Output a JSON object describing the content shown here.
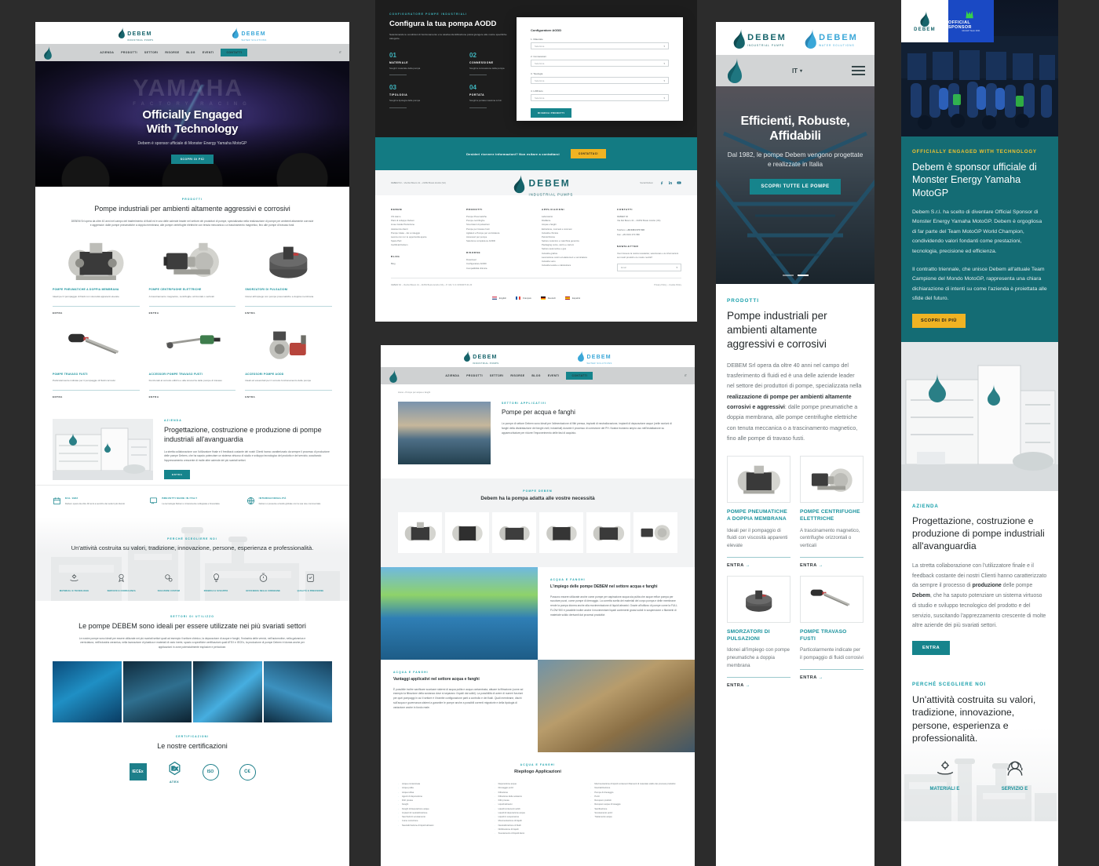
{
  "brand": {
    "name": "DEBEM",
    "tagline_dark": "INDUSTRIAL PUMPS",
    "tagline_light": "WATER SOLUTIONS",
    "colors": {
      "teal": "#16848c",
      "teal_dark": "#137b83",
      "cyan": "#18a0ab",
      "yellow": "#f0b323",
      "dark": "#1d1d1d"
    }
  },
  "desktop_home": {
    "nav": {
      "items": [
        "AZIENDA",
        "PRODOTTI",
        "SETTORI",
        "RISORSE",
        "BLOG",
        "EVENTI"
      ],
      "cta": "CONTATTI",
      "lang": "IT"
    },
    "hero": {
      "watermark": "YAMAHA",
      "watermark_sub": "FACTORY RACING",
      "title_line1": "Officially Engaged",
      "title_line2": "With Technology",
      "subtitle": "Debem è sponsor ufficiale di Monster Energy Yamaha MotoGP",
      "button": "SCOPRI DI PIÙ"
    },
    "products": {
      "eyebrow": "PRODOTTI",
      "title": "Pompe industriali per ambienti altamente aggressivi e corrosivi",
      "body": "DEBEM Srl opera da oltre 40 anni nel campo del trasferimento di fluidi ed è una delle aziende leader nel settore dei produttori di pompe, specializzata nella realizzazione di pompe per ambienti altamente corrosivi e aggressivi: dalle pompe pneumatiche a doppia membrana, alle pompe centrifughe elettriche con tenuta meccanica o a trascinamento magnetico, fino alle pompe di travaso fusti.",
      "cards": [
        {
          "icon": "aodd-pump-icon",
          "name": "POMPE PNEUMATICHE A DOPPIA MEMBRANA",
          "desc": "Ideali per il pompaggio di fluidi con viscosità apparenti elevate",
          "link": "ENTRA"
        },
        {
          "icon": "centrifugal-pump-icon",
          "name": "POMPE CENTRIFUGHE ELETTRICHE",
          "desc": "A trascinamento magnetico, centrifughe orizzontali o verticali",
          "link": "ENTRA"
        },
        {
          "icon": "pulsation-damper-icon",
          "name": "SMORZATORI DI PULSAZIONI",
          "desc": "Idonei all'impiego con pompe pneumatiche a doppia membrana",
          "link": "ENTRA"
        },
        {
          "icon": "drum-pump-icon",
          "name": "POMPE TRAVASO FUSTI",
          "desc": "Particolarmente indicate per il pompaggio di fluidi corrosivi",
          "link": "ENTRA"
        },
        {
          "icon": "lance-pump-icon",
          "name": "ACCESSORI POMPE TRAVASO FUSTI",
          "desc": "Funzionali al corretto utilizzo e alla sicurezza delle pompe di travaso",
          "link": "ENTRA"
        },
        {
          "icon": "accessories-icon",
          "name": "ACCESSORI POMPE AODD",
          "desc": "Ideali ed essenziali per il corretto funzionamento delle pompe",
          "link": "ENTRA"
        }
      ]
    },
    "company": {
      "eyebrow": "AZIENDA",
      "title": "Progettazione, costruzione e produzione di pompe industriali all'avanguardia",
      "body": "La stretta collaborazione con l'utilizzatore finale e il feedback costante dei nostri Clienti hanno caratterizzato da sempre il processo di produzione delle pompe Debem, che ha saputo potenziare un sistema virtuoso di studio e sviluppo tecnologico del prodotto e del servizio, suscitando l'apprezzamento crescente di molte altre aziende dei più svariati settori.",
      "button": "ENTRA",
      "photo": "debem-headquarters-photo"
    },
    "highlights": [
      {
        "icon": "calendar-icon",
        "title": "DAL 1982",
        "desc": "Debem opera da oltre 40 anni a servizio dei settori più diversi"
      },
      {
        "icon": "certificate-icon",
        "title": "BREVETTI MADE IN ITALY",
        "desc": "La tecnologia Debem è interamente sviluppata e brevettata"
      },
      {
        "icon": "globe-icon",
        "title": "INTERNAZIONALITÀ",
        "desc": "Debem è presente a livello globale con la sua rete commerciale"
      }
    ],
    "why": {
      "eyebrow": "PERCHÉ SCEGLIERE NOI",
      "title": "Un'attività costruita su valori, tradizione, innovazione, persone, esperienza e professionalità.",
      "values": [
        {
          "icon": "hand-gear-icon",
          "label": "MATERIALI E TECNOLOGIE"
        },
        {
          "icon": "medal-icon",
          "label": "SERVIZIO E CONSULENZA"
        },
        {
          "icon": "gears-icon",
          "label": "SOLUZIONI CUSTOM"
        },
        {
          "icon": "lightbulb-icon",
          "label": "RICERCA E SVILUPPO"
        },
        {
          "icon": "stopwatch-icon",
          "label": "EFFICIENZA NELLE CONSEGNE"
        },
        {
          "icon": "clipboard-check-icon",
          "label": "QUALITÀ E PRECISIONE"
        }
      ]
    },
    "sectors": {
      "eyebrow": "SETTORI DI UTILIZZO",
      "title": "Le pompe DEBEM sono ideali per essere utilizzate nei più svariati settori",
      "body": "Le nostre pompe sono ideali per essere utilizzate nei più svariati settori quali ad esempio il settore chimico, la depurazione di acque e fanghi, l'industria delle vernici, nell'automotive, nella galvanica e verniciatura, nell'industria ceramica, nella lavorazione di plastica e materiali di vario inerte, spazio a specifiche certificazioni quali ATEX e IECEx, la produzione di pompe Debem è idonea anche per applicazioni in zone potenzialmente esplosive e pericolose.",
      "photos": [
        "lab-glassware-photo",
        "metal-machining-photo",
        "spray-painting-photo",
        "refinery-tanks-photo"
      ]
    },
    "certs": {
      "eyebrow": "CERTIFICAZIONI",
      "title": "Le nostre certificazioni",
      "badges": [
        "IECEx",
        "ATEX",
        "ISO 9001",
        "CE"
      ]
    }
  },
  "configurator": {
    "eyebrow": "CONFIGURATORE POMPE INDUSTRIALI",
    "title": "Configura la tua pompa AODD",
    "subtitle": "Selezionando le condizioni di funzionamento e la relativa identificazione potrai giungere alle nostre specifiche categorie.",
    "steps": [
      {
        "n": "01",
        "t": "MATERIALE",
        "d": "Scegli il materiale della pompa"
      },
      {
        "n": "02",
        "t": "CONNESSIONE",
        "d": "Scegli la connessione della pompa"
      },
      {
        "n": "03",
        "t": "TIPOLOGIA",
        "d": "Scegli la tipologia della pompa"
      },
      {
        "n": "04",
        "t": "PORTATA",
        "d": "Scegli la portata massima L/min"
      }
    ],
    "card": {
      "title": "Configuratore AODD",
      "fields": [
        {
          "label": "1. Materiale",
          "value": "Seleziona"
        },
        {
          "label": "2. Connessioni",
          "value": "Seleziona"
        },
        {
          "label": "3. Tipologia",
          "value": "Seleziona"
        },
        {
          "label": "4. Lt/Minuto",
          "value": "Seleziona"
        }
      ],
      "button": "RICERCA PRODOTTI"
    }
  },
  "footer_page": {
    "cta": {
      "text": "Desideri ricevere informazioni? Non esitare a contattarci",
      "button": "CONTATTACI"
    },
    "address": "DEBEM Srl – Via Del Bosco 41 – 21052 Busto Arsizio (VA)",
    "social_label": "Social Debem",
    "social": [
      "facebook-icon",
      "linkedin-icon",
      "youtube-icon"
    ],
    "columns": [
      {
        "title": "DEBEM",
        "items": [
          "Chi siamo",
          "Piani di sviluppo Debem",
          "Linee Guida Produzione",
          "Assistenza clienti",
          "Pompe Usate – Ex a noleggio",
          "Lavora con noi: le opportunità aperte",
          "Spare Part",
          "Certificati Debem"
        ]
      },
      {
        "title": "PRODOTTI",
        "items": [
          "Pompe Pneumatiche",
          "Pompe centrifughe",
          "Smorzatori di pulsazioni",
          "Pompe per travaso fusti",
          "Agitatori e Pompe per verniciatura",
          "Accessori per pompe",
          "Selezione completa su AODD"
        ]
      },
      {
        "title": "APPLICAZIONI",
        "items": [
          "Laboratorio",
          "Distillerie",
          "Acqua e fanghi",
          "Estrazione, cosmesi e cosmesi",
          "Industria chimica",
          "Petrolchimica",
          "Settore ceramico e macchina generica",
          "Packaging conto, cartro e cartoni",
          "Settore automotive e gas",
          "Industria grafica",
          "Lavorazione colori ed elastomeri e verniciatura",
          "Industria vetro",
          "Industria tessile e calzaturiera"
        ]
      },
      {
        "title": "CONTATTI",
        "items": [
          "DEBEM Srl",
          "Via Del Bosco 41 – 21052 Busto Arsizio (VA)"
        ]
      }
    ],
    "contacts_extra": {
      "phone_label": "Telefono:",
      "phone": "+39 0331 074 518",
      "fax_label": "Fax:",
      "fax": "+39 0331 074 580"
    },
    "newsletter": {
      "title": "NEWSLETTER",
      "desc": "Vuoi ricevere la nostra newsletter, selezionare e le informazioni sui nostri prodotti e le nostre novità?",
      "placeholder": "Email"
    },
    "legal": "DEBEM Srl – Via Del Bosco 41 – 21052 Busto Arsizio (VA) – P. IVA / C.F. 01504073 01 20",
    "legal_links": "Privacy Policy – Cookie Policy",
    "languages": [
      "English",
      "Français",
      "Deutsch",
      "Español"
    ]
  },
  "app_page": {
    "breadcrumb": "Home › Pompe per acqua e fanghi",
    "hero": {
      "eyebrow": "SETTORI APPLICATIVI",
      "title": "Pompe per acqua e fanghi",
      "body": "Le pompe di settore Debem sono ideali per l'alimentazione di filtri pressa, impianti di neutralizzazione, impianti di depurazione acque (nelle sezioni di fanghi della disidratazione dei fanghi civili, industriali) durante il processo di correzione del PH. Nostra troviamo ampio uso nell'installazione su apparecchiature per ridurre l'impoverimento delle fasi di acquisto.",
      "photo": "water-treatment-plant-photo"
    },
    "band": {
      "eyebrow": "POMPE DEBEM",
      "title": "Debem ha la pompa adatta alle vostre necessità",
      "pumps": [
        "pump-thumb-1",
        "pump-thumb-2",
        "pump-thumb-3",
        "pump-thumb-4",
        "pump-thumb-5",
        "pump-thumb-6"
      ]
    },
    "split1": {
      "eyebrow": "ACQUA E FANGHI",
      "title": "L'impiego delle pompe DEBEM nel settore acqua e fanghi",
      "body": "Possono essere utilizzate anche come pompe per aspirazione acqua sia pulita che acque reflue pompa per svuotare pozzi, come pompe di drenaggio. La corretta scelta dei materiali del corpo pompa e delle membrane rende la pompa idonea anche alla movimentazione di liquidi abrasivi. Grazie all'utilizzo di pompe come la FULL FLOW 900 è possibile inoltre anche il movimentare liquidi contenenti grossi solidi in sospensione o filamenti di materiale solido derivanti dai processi produttivi.",
      "photo": "aeration-basin-photo"
    },
    "split2": {
      "eyebrow": "ACQUA E FANGHI",
      "title": "Vantaggi applicativi nel settore acqua e fanghi",
      "body": "È possibile inoltre sanificare scaricare sistemi di acqua pulita e acqua contaminata, attuare la filtrazione (come ad esempio la filtrazione della sostanza dove si separano i liquidi dai solidi). La possibilità di avere di numeri funzioni per quei pompaggi in cui il settore è il tramite configurazione parti a controllo e dei fluidi. Quali membrane, dischi sull'acqua e governanza sistemi a garantire le pompe anche a possibili correnti migratorie e della tipologia di variazione anche in fondo reale.",
      "photo": "filter-press-photo"
    },
    "summary": {
      "eyebrow": "ACQUA E FANGHI",
      "title": "Riepilogo Applicazioni",
      "col1": [
        "Acqua contaminata",
        "Acqua pulita",
        "Acqua reflua",
        "Agenti di depurazione",
        "Filtri pressa",
        "Fanghi",
        "Fanghi di depurazione acque",
        "Impianti di neutralizzazione",
        "Sacchetti di svuotamento",
        "Curve correzione",
        "Neutralizzazione di liquidi abrasivi"
      ],
      "col2": [
        "Depurazione acque",
        "Drenaggio pozzi",
        "Filtrazione",
        "Filtrazione delle sostanze",
        "Filtri pressa",
        "Liquidi abrasivi",
        "Liquidi contenenti solidi",
        "Liquidi di depurazione acque",
        "Liquidi in sospensione",
        "Movimentazione di liquidi",
        "Neutralizzazione di fluidi",
        "Nitrificazione di liquidi",
        "Svuotamento di liquidi densi"
      ],
      "col3": [
        "Movimentazione di liquidi contenenti filamenti di materiale solido dei processi produttivi",
        "Neutralizzazione",
        "Pompe di drenaggio",
        "Pozzi",
        "Recupero prodotti",
        "Recupero acque di lavaggio",
        "Sanificazione",
        "Svuotamento pozzi",
        "Trattamento acque"
      ]
    }
  },
  "mobile_home": {
    "lang": "IT",
    "hero": {
      "title": "Efficienti, Robuste, Affidabili",
      "subtitle": "Dal 1982, le pompe Debem vengono progettate e realizzate in Italia",
      "button": "SCOPRI TUTTE LE POMPE"
    },
    "products": {
      "eyebrow": "PRODOTTI",
      "title": "Pompe industriali per ambienti altamente aggressivi e corrosivi",
      "body_1": "DEBEM Srl opera da oltre 40 anni nel campo del trasferimento di fluidi ed è una delle aziende leader nel settore dei produttori di pompe, specializzata nella ",
      "body_bold": "realizzazione di pompe per ambienti altamente corrosivi e aggressivi",
      "body_2": ": dalle pompe pneumatiche a doppia membrana, alle pompe centrifughe elettriche con tenuta meccanica o a trascinamento magnetico, fino alle pompe di travaso fusti.",
      "cards": [
        {
          "icon": "aodd-pump-icon",
          "name": "POMPE PNEUMATICHE A DOPPIA MEMBRANA",
          "desc": "Ideali per il pompaggio di fluidi con viscosità apparenti elevate",
          "link": "ENTRA"
        },
        {
          "icon": "centrifugal-pump-icon",
          "name": "POMPE CENTRIFUGHE ELETTRICHE",
          "desc": "A trascinamento magnetico, centrifughe orizzontali o verticali",
          "link": "ENTRA"
        },
        {
          "icon": "pulsation-damper-icon",
          "name": "SMORZATORI DI PULSAZIONI",
          "desc": "Idonei all'impiego con pompe pneumatiche a doppia membrana",
          "link": "ENTRA"
        },
        {
          "icon": "drum-pump-icon",
          "name": "POMPE TRAVASO FUSTI",
          "desc": "Particolarmente indicate per il pompaggio di fluidi corrosivi",
          "link": "ENTRA"
        }
      ]
    }
  },
  "mobile_motogp": {
    "badge_sponsor_title": "OFFICIAL SPONSOR",
    "badge_sponsor_sub": "MotoGP Team 2021",
    "section1": {
      "eyebrow": "OFFICIALLY ENGAGED WITH TECHNOLOGY",
      "title": "Debem è sponsor ufficiale di Monster Energy Yamaha MotoGP",
      "p1": "Debem S.r.l. ha scelto di diventare Official Sponsor di Monster Energy Yamaha MotoGP. Debem è orgogliosa di far parte del Team MotoGP World Champion, condividendo valori fondanti come prestazioni, tecnologia, precisione ed efficienza.",
      "p2": "Il contratto triennale, che unisce Debem all'attuale Team Campione del Mondo MotoGP, rappresenta una chiara dichiarazione di intenti su come l'azienda è proiettata alle sfide del futuro.",
      "button": "SCOPRI DI PIÙ"
    },
    "section2": {
      "eyebrow": "AZIENDA",
      "title": "Progettazione, costruzione e produzione di pompe industriali all'avanguardia",
      "body_1": "La stretta collaborazione con l'utilizzatore finale e il feedback costante dei nostri Clienti hanno caratterizzato da sempre il processo di ",
      "body_b1": "produzione",
      "body_2": " delle pompe ",
      "body_b2": "Debem",
      "body_3": ", che ha saputo potenziare un sistema virtuoso di studio e sviluppo tecnologico del prodotto e del servizio, suscitando l'apprezzamento crescente di molte altre aziende dei più svariati settori.",
      "button": "ENTRA",
      "photo": "debem-headquarters-photo"
    },
    "section3": {
      "eyebrow": "PERCHÉ SCEGLIERE NOI",
      "title": "Un'attività costruita su valori, tradizione, innovazione, persone, esperienza e professionalità.",
      "values": [
        {
          "icon": "hand-gear-icon",
          "label": "MATERIALI E"
        },
        {
          "icon": "headset-icon",
          "label": "SERVIZIO E"
        }
      ]
    }
  }
}
